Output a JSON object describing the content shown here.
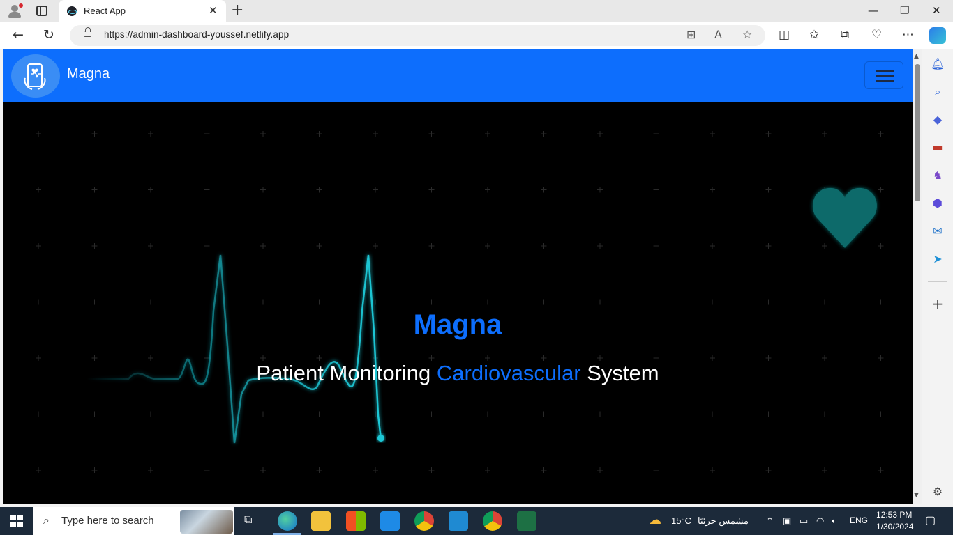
{
  "browser": {
    "tab_title": "React App",
    "url": "https://admin-dashboard-youssef.netlify.app"
  },
  "page": {
    "brand": "Magna",
    "hero_title": "Magna",
    "hero_sub_part1": "Patient Monitoring ",
    "hero_sub_accent": "Cardiovascular",
    "hero_sub_part2": " System",
    "accent_color": "#0d6efd",
    "heart_color": "#0e6b6b",
    "ecg_color": "#1cc8d6"
  },
  "taskbar": {
    "search_placeholder": "Type here to search",
    "weather_temp": "15°C",
    "weather_text": "مشمس جزئيًا",
    "language": "ENG",
    "time": "12:53 PM",
    "date": "1/30/2024"
  }
}
